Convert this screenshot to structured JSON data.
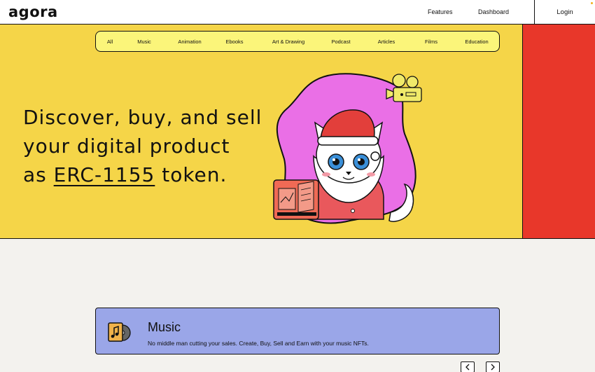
{
  "header": {
    "logo": "agora",
    "nav": [
      "Features",
      "Dashboard"
    ],
    "login": "Login"
  },
  "categories": [
    "All",
    "Music",
    "Animation",
    "Ebooks",
    "Art & Drawing",
    "Podcast",
    "Articles",
    "Films",
    "Education"
  ],
  "hero": {
    "line1": "Discover, buy, and sell",
    "line2": "your digital product",
    "line3_prefix": "as ",
    "line3_token": "ERC-1155",
    "line3_suffix": " token.",
    "illustration_icons": [
      "cat-santa-illustration",
      "film-projector-icon",
      "book-icon"
    ]
  },
  "colors": {
    "hero_bg": "#f5d548",
    "side_bg": "#e8372a",
    "category_bar_bg": "#fbf57a",
    "music_card_bg": "#9aa6e8",
    "page_bg": "#f3f2ee",
    "blob_pink": "#ea6fe6"
  },
  "music": {
    "title": "Music",
    "description": "No middle man cutting your sales. Create, Buy, Sell and Earn with your music NFTs.",
    "icon": "music-album-icon"
  },
  "carousel": {
    "prev_icon": "chevron-left-icon",
    "next_icon": "chevron-right-icon"
  }
}
